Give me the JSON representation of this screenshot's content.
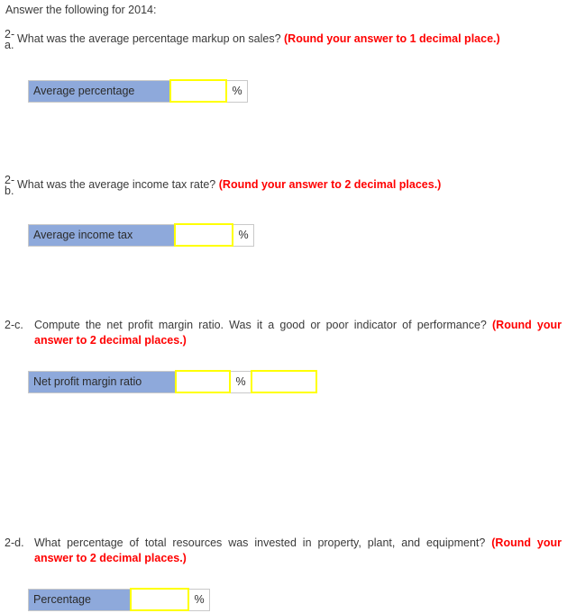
{
  "intro": "Answer the following for 2014:",
  "colors": {
    "header_blue": "#8ea9db",
    "field_border_yellow": "#ffff00",
    "hint_red": "#ff0000",
    "table_border_gray": "#c9c9c9"
  },
  "questions": [
    {
      "num_line1": "2-",
      "num_line2": "a.",
      "num_inline": "2-a.",
      "text": "What was the average percentage markup on sales?",
      "hint": "(Round your answer to 1 decimal place.)",
      "table": {
        "label": "Average percentage",
        "value": "",
        "placeholder": "",
        "percent_symbol": "%",
        "extra_value": null,
        "extra_placeholder": null
      }
    },
    {
      "num_line1": "2-",
      "num_line2": "b.",
      "num_inline": "2-b.",
      "text": "What was the average income tax rate?",
      "hint": "(Round your answer to 2 decimal places.)",
      "table": {
        "label": "Average income tax",
        "value": "",
        "placeholder": "",
        "percent_symbol": "%",
        "extra_value": null,
        "extra_placeholder": null
      }
    },
    {
      "num_line1": "2-",
      "num_line2": "c.",
      "num_inline": "2-c.",
      "text": "Compute the net profit margin ratio. Was it a good or poor indicator of performance?",
      "hint": "(Round your answer to 2 decimal places.)",
      "text_line1": "Compute the net profit margin ratio. Was it a good or poor indicator of performance?",
      "hint_line1": "(Round your",
      "hint_line2": "answer to 2 decimal places.)",
      "table": {
        "label": "Net profit margin ratio",
        "value": "",
        "placeholder": "",
        "percent_symbol": "%",
        "extra_value": "",
        "extra_placeholder": ""
      }
    },
    {
      "num_line1": "2-",
      "num_line2": "d.",
      "num_inline": "2-d.",
      "text": "What percentage of total resources was invested in property, plant, and equipment?",
      "hint": "(Round your answer to 2 decimal places.)",
      "text_line1": "What percentage of total resources was invested in property, plant, and equipment?",
      "hint_line1": "(Round your",
      "hint_line2": "answer to 2 decimal places.)",
      "table": {
        "label": "Percentage",
        "value": "",
        "placeholder": "",
        "percent_symbol": "%",
        "extra_value": null,
        "extra_placeholder": null
      }
    }
  ]
}
